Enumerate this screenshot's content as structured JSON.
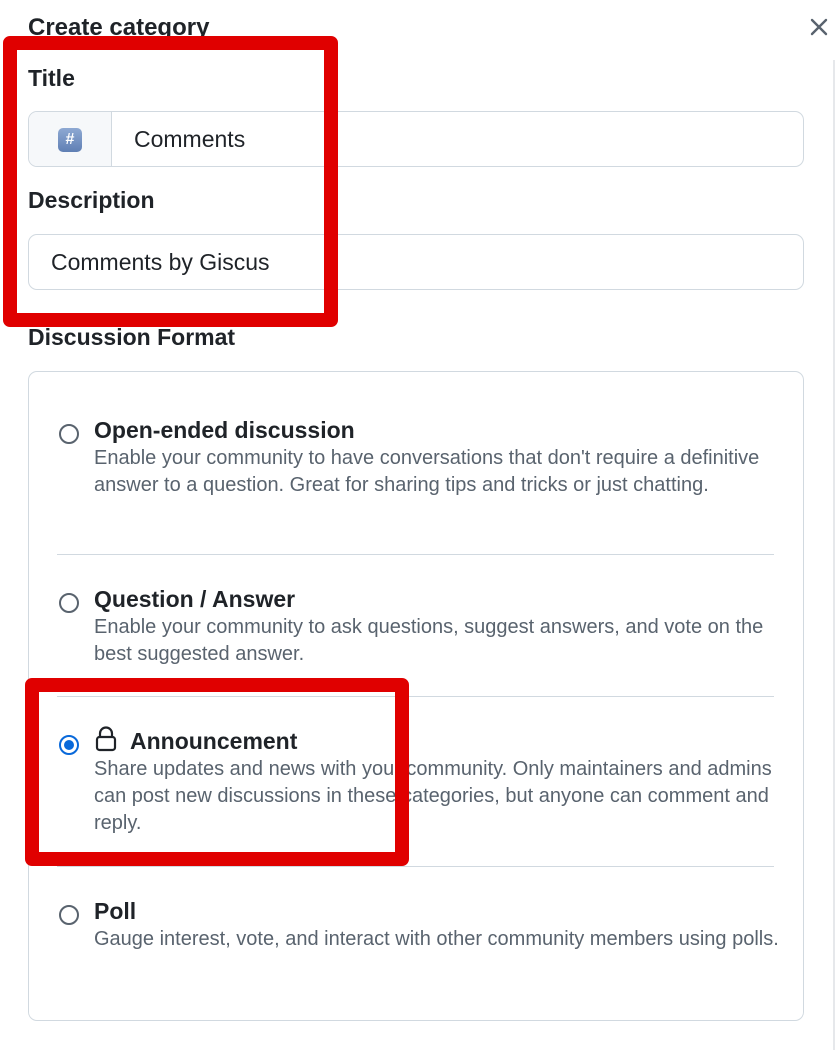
{
  "dialog": {
    "title": "Create category",
    "close_icon": "close-icon"
  },
  "form": {
    "title_label": "Title",
    "title_emoji": "#",
    "title_emoji_icon": "hash-emoji-icon",
    "title_value": "Comments",
    "description_label": "Description",
    "description_value": "Comments by Giscus",
    "format_label": "Discussion Format"
  },
  "formats": [
    {
      "title": "Open-ended discussion",
      "description": "Enable your community to have conversations that don't require a definitive answer to a question. Great for sharing tips and tricks or just chatting.",
      "selected": false
    },
    {
      "title": "Question / Answer",
      "description": "Enable your community to ask questions, suggest answers, and vote on the best suggested answer.",
      "selected": false
    },
    {
      "title": "Announcement",
      "icon": "lock-icon",
      "description": "Share updates and news with your community. Only maintainers and admins can post new discussions in these categories, but anyone can comment and reply.",
      "selected": true
    },
    {
      "title": "Poll",
      "description": "Gauge interest, vote, and interact with other community members using polls.",
      "selected": false
    }
  ],
  "colors": {
    "highlight": "#e00000",
    "accent": "#0969da",
    "border": "#d1d9e0",
    "muted_text": "#59636e"
  }
}
